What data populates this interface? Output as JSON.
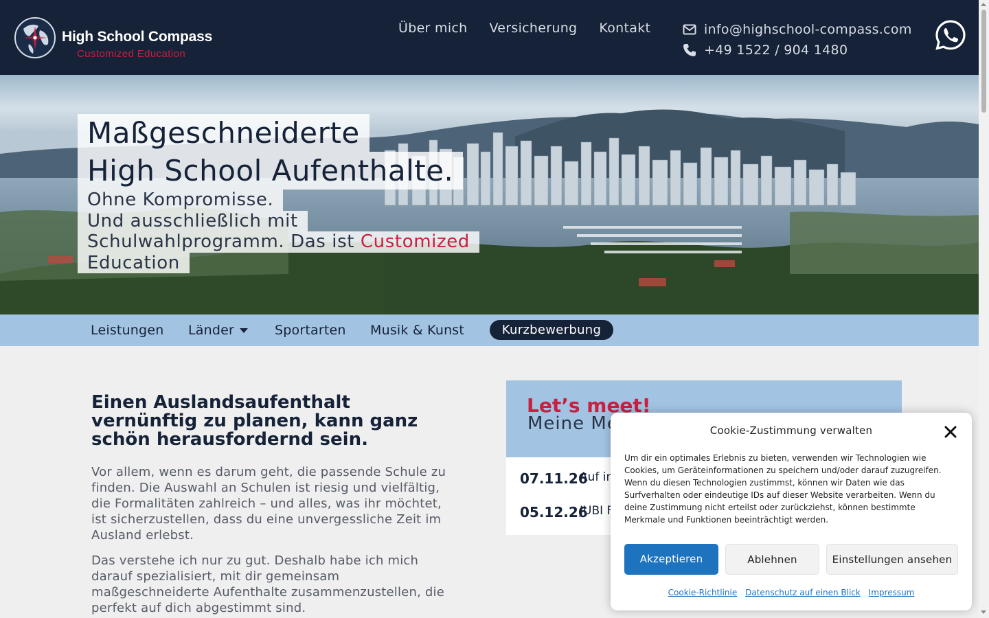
{
  "header": {
    "logo_name": "High School Compass",
    "logo_sub": "Customized Education",
    "nav": [
      "Über mich",
      "Versicherung",
      "Kontakt"
    ],
    "email": "info@highschool-compass.com",
    "phone": "+49 1522 / 904 1480",
    "icons": {
      "email": "envelope-icon",
      "phone": "phone-icon",
      "whatsapp": "whatsapp-icon"
    }
  },
  "hero": {
    "title_line1": "Maßgeschneiderte",
    "title_line2": "High School Aufenthalte.",
    "sub_line1": "Ohne Kompromisse.",
    "sub_line2": "Und ausschließlich mit",
    "sub_line3_prefix": "Schulwahlprogramm. Das ist ",
    "sub_line3_accent": "Customized",
    "sub_line4_accent": "Education"
  },
  "subnav": {
    "items": [
      "Leistungen",
      "Länder",
      "Sportarten",
      "Musik & Kunst"
    ],
    "cta": "Kurzbewerbung"
  },
  "main": {
    "heading": "Einen Auslandsaufenthalt vernünftig zu planen, kann ganz schön herausfordernd sein.",
    "para1": "Vor allem, wenn es darum geht, die passende Schule zu finden. Die Auswahl an Schulen ist riesig und vielfältig, die Formalitäten zahlreich – und alles, was ihr möchtet, ist sicherzustellen, dass du eine unvergessliche Zeit im Ausland erlebst.",
    "para2": "Das verstehe ich nur zu gut. Deshalb habe ich mich darauf spezialisiert, mit dir gemeinsam maßgeschneiderte Aufenthalte zusammenzustellen, die perfekt auf dich abgestimmt sind."
  },
  "meet": {
    "title": "Let’s meet!",
    "subtitle": "Meine Me",
    "events": [
      {
        "date": "07.11.26",
        "text": "Auf in Röme"
      },
      {
        "date": "05.12.26",
        "text": "JUBI F"
      }
    ]
  },
  "cookie": {
    "title": "Cookie-Zustimmung verwalten",
    "body": "Um dir ein optimales Erlebnis zu bieten, verwenden wir Technologien wie Cookies, um Geräteinformationen zu speichern und/oder darauf zuzugreifen. Wenn du diesen Technologien zustimmst, können wir Daten wie das Surfverhalten oder eindeutige IDs auf dieser Website verarbeiten. Wenn du deine Zustimmung nicht erteilst oder zurückziehst, können bestimmte Merkmale und Funktionen beeinträchtigt werden.",
    "accept": "Akzeptieren",
    "deny": "Ablehnen",
    "prefs": "Einstellungen ansehen",
    "links": [
      "Cookie-Richtlinie",
      "Datenschutz auf einen Blick",
      "Impressum"
    ]
  },
  "colors": {
    "navy": "#152238",
    "accent_red": "#c8203f",
    "light_blue": "#a3c3e3",
    "cookie_blue": "#1e73be"
  }
}
